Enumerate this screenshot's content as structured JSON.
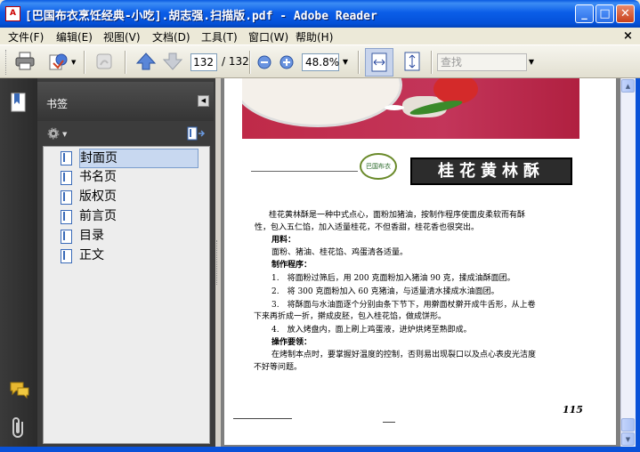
{
  "window": {
    "title": "[巴国布衣烹饪经典-小吃].胡志强.扫描版.pdf - Adobe Reader",
    "icon": "pdf-app-icon"
  },
  "menu": [
    "文件(F)",
    "编辑(E)",
    "视图(V)",
    "文档(D)",
    "工具(T)",
    "窗口(W)",
    "帮助(H)"
  ],
  "toolbar": {
    "page_current": "132",
    "page_total": "/ 132",
    "zoom": "48.8%",
    "search_placeholder": "查找"
  },
  "bookmarks": {
    "title": "书签",
    "items": [
      "封面页",
      "书名页",
      "版权页",
      "前言页",
      "目录",
      "正文"
    ],
    "selected": "封面页"
  },
  "document": {
    "logo_text": "巴国布衣",
    "headline": "桂花黄林酥",
    "lines": [
      "桂花黄林酥是一种中式点心，面粉加猪油，按制作程序使面皮柔软而有酥",
      "性，包入五仁馅，加入适量桂花，不但香甜，桂花香也很突出。",
      "用料：",
      "面粉、猪油、桂花馅、鸡蛋清各适量。",
      "制作程序：",
      "1.　将面粉过筛后，用 200 克面粉加入猪油 90 克，揉成油酥面团。",
      "2.　将 300 克面粉加入 60 克猪油，与适量清水揉成水油面团。",
      "3.　将酥面与水油面逐个分别由条下节下，用擀面杖擀开成牛舌形，从上卷",
      "下来再折成一折，擀成皮胚，包入桂花馅，做成饼形。",
      "4.　放入烤盘内，面上刷上鸡蛋液，进炉烘烤至熟即成。",
      "操作要领：",
      "在烤制本点时，要掌握好温度的控制，否则易出现裂口以及点心表皮光洁度",
      "不好等问题。"
    ],
    "page_number": "115"
  },
  "colors": {
    "titlebar": "#0a5ae0",
    "photo": "#c3355a",
    "panel": "#3c3c3c",
    "doc_bg": "#7f7f7f"
  }
}
